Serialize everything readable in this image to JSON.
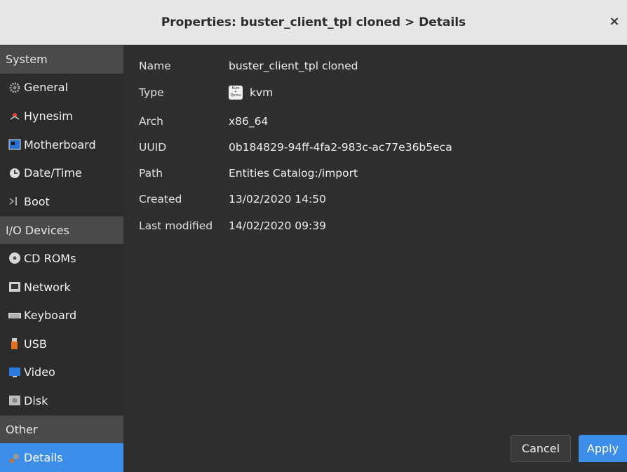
{
  "window": {
    "title": "Properties: buster_client_tpl cloned > Details",
    "close_glyph": "×"
  },
  "sidebar": {
    "sections": [
      {
        "header": "System",
        "items": [
          {
            "label": "General",
            "icon": "gear-icon"
          },
          {
            "label": "Hynesim",
            "icon": "hynesim-icon"
          },
          {
            "label": "Motherboard",
            "icon": "motherboard-icon"
          },
          {
            "label": "Date/Time",
            "icon": "clock-icon"
          },
          {
            "label": "Boot",
            "icon": "boot-icon"
          }
        ]
      },
      {
        "header": "I/O Devices",
        "items": [
          {
            "label": "CD ROMs",
            "icon": "cdrom-icon"
          },
          {
            "label": "Network",
            "icon": "network-icon"
          },
          {
            "label": "Keyboard",
            "icon": "keyboard-icon"
          },
          {
            "label": "USB",
            "icon": "usb-icon"
          },
          {
            "label": "Video",
            "icon": "monitor-icon"
          },
          {
            "label": "Disk",
            "icon": "disk-icon"
          }
        ]
      },
      {
        "header": "Other",
        "items": [
          {
            "label": "Details",
            "icon": "details-icon",
            "selected": true
          }
        ]
      }
    ]
  },
  "details": {
    "rows": [
      {
        "label": "Name",
        "value": "buster_client_tpl cloned"
      },
      {
        "label": "Type",
        "value": "kvm",
        "icon": "kvm-qemu-icon",
        "badge_text": [
          "Kvm",
          "+",
          "Qemu"
        ]
      },
      {
        "label": "Arch",
        "value": "x86_64"
      },
      {
        "label": "UUID",
        "value": "0b184829-94ff-4fa2-983c-ac77e36b5eca"
      },
      {
        "label": "Path",
        "value": "Entities Catalog:/import"
      },
      {
        "label": "Created",
        "value": "13/02/2020 14:50"
      },
      {
        "label": "Last modified",
        "value": "14/02/2020 09:39"
      }
    ]
  },
  "buttons": {
    "cancel": "Cancel",
    "apply": "Apply"
  },
  "colors": {
    "selection": "#3d8ee8",
    "background": "#2f2f2f",
    "titlebar": "#e6e6e6"
  }
}
